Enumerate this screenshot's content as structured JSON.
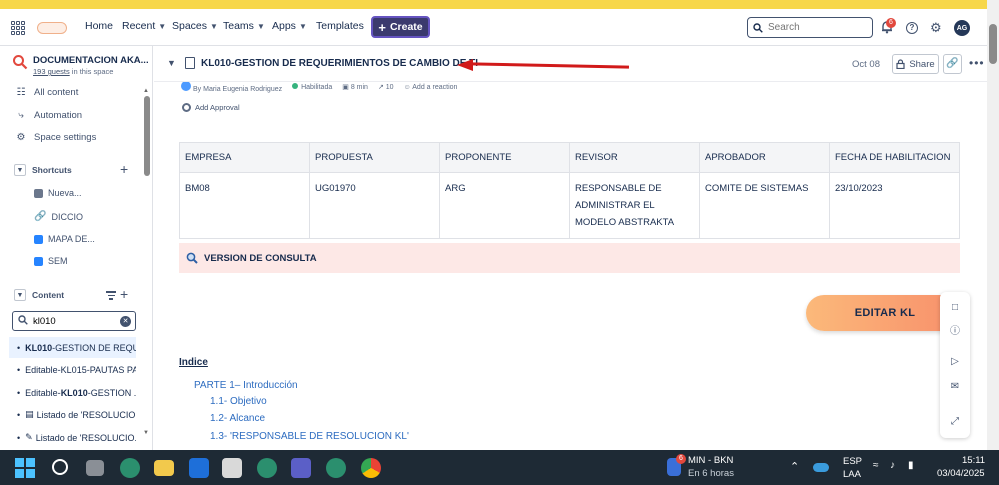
{
  "topnav": {
    "items": [
      "Home",
      "Recent",
      "Spaces",
      "Teams",
      "Apps",
      "Templates"
    ],
    "create_label": "Create",
    "search_placeholder": "Search",
    "notification_count": "6",
    "avatar_initials": "AG"
  },
  "sidebar": {
    "space_name": "DOCUMENTACION AKA...",
    "guests_count": "193 guests",
    "guests_suffix": " in this space",
    "nav": [
      "All content",
      "Automation",
      "Space settings"
    ],
    "shortcuts_label": "Shortcuts",
    "shortcuts": [
      "Nueva...",
      "DICCIO",
      "MAPA DE...",
      "SEM"
    ],
    "content_label": "Content",
    "filter_value": "kl010",
    "tree": [
      {
        "bold": "KL010",
        "rest": "-GESTION DE REQU..."
      },
      {
        "bold": "",
        "rest": "Editable-KL015-PAUTAS PA..."
      },
      {
        "bold": "KL010",
        "prefix": "Editable-",
        "rest": "-GESTION ..."
      },
      {
        "bold": "",
        "rest": "Listado de 'RESOLUCIO..."
      },
      {
        "bold": "",
        "rest": "Listado de 'RESOLUCIO..."
      }
    ]
  },
  "page": {
    "title": "KL010-GESTION DE REQUERIMIENTOS DE CAMBIO DE TI",
    "date": "Oct 08",
    "share_label": "Share",
    "meta": {
      "author": "By Maria Eugenia Rodriguez",
      "status": "Habilitada",
      "read_time": "8 min",
      "views": "10",
      "reaction": "Add a reaction"
    },
    "approval_label": "Add Approval",
    "table": {
      "headers": [
        "EMPRESA",
        "PROPUESTA",
        "PROPONENTE",
        "REVISOR",
        "APROBADOR",
        "FECHA DE HABILITACION"
      ],
      "row": [
        "BM08",
        "UG01970",
        "ARG",
        "RESPONSABLE DE ADMINISTRAR EL MODELO ABSTRAKTA",
        "COMITE DE SISTEMAS",
        "23/10/2023"
      ]
    },
    "version_label": "VERSION DE CONSULTA",
    "edit_button": "EDITAR KL",
    "index_title": "Indice",
    "toc": [
      "PARTE 1– Introducción",
      "1.1- Objetivo",
      "1.2- Alcance",
      "1.3- 'RESPONSABLE DE RESOLUCION KL'"
    ]
  },
  "taskbar": {
    "weather_badge": "6",
    "weather_title": "MIN - BKN",
    "weather_sub": "En 6 horas",
    "lang": "ESP",
    "lang_sub": "LAA",
    "time": "15:11",
    "date": "03/04/2025"
  }
}
